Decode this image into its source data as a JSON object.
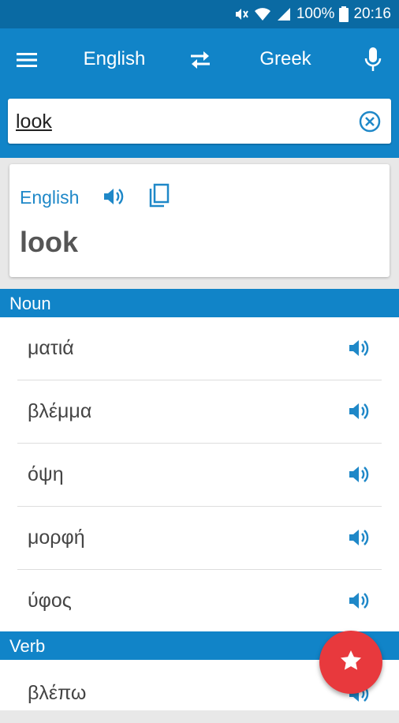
{
  "status_bar": {
    "battery": "100%",
    "time": "20:16",
    "icons": [
      "mute-icon",
      "wifi-icon",
      "signal-icon",
      "battery-icon"
    ]
  },
  "toolbar": {
    "menu_icon": "menu-icon",
    "source_language": "English",
    "swap_icon": "swap-icon",
    "target_language": "Greek",
    "mic_icon": "mic-icon"
  },
  "search": {
    "value": "look",
    "clear_icon": "clear-icon"
  },
  "result_card": {
    "language": "English",
    "speaker_icon": "speaker-icon",
    "copy_icon": "copy-icon",
    "word": "look"
  },
  "sections": [
    {
      "header": "Noun",
      "items": [
        "ματιά",
        "βλέμμα",
        "όψη",
        "μορφή",
        "ύφος"
      ]
    },
    {
      "header": "Verb",
      "items": [
        "βλέπω"
      ]
    }
  ],
  "fab_icon": "star-icon",
  "colors": {
    "status_bar": "#0a6aa3",
    "primary": "#1184c8",
    "accent_link": "#1f88c8",
    "fab": "#e8393d",
    "background": "#e8e8e8"
  }
}
